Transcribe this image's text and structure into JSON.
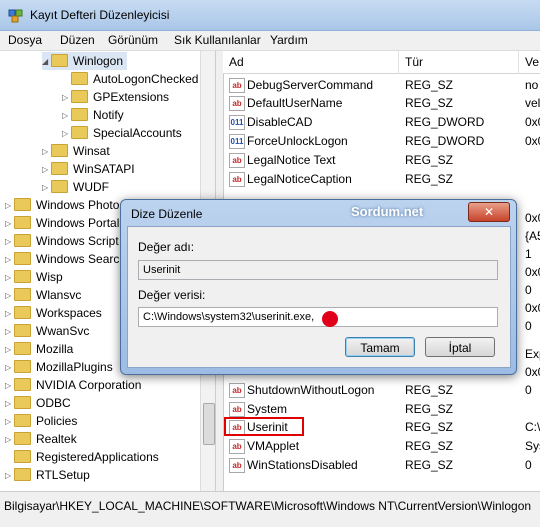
{
  "window": {
    "title": "Kayıt Defteri Düzenleyicisi"
  },
  "menu": [
    "Dosya",
    "Düzen",
    "Görünüm",
    "Sık Kullanılanlar",
    "Yardım"
  ],
  "tree": {
    "items": [
      {
        "label": "Winlogon",
        "expander": "◢"
      },
      {
        "label": "AutoLogonChecked",
        "expander": ""
      },
      {
        "label": "GPExtensions",
        "expander": "▷"
      },
      {
        "label": "Notify",
        "expander": "▷"
      },
      {
        "label": "SpecialAccounts",
        "expander": "▷"
      },
      {
        "label": "Winsat",
        "expander": "▷"
      },
      {
        "label": "WinSATAPI",
        "expander": "▷"
      },
      {
        "label": "WUDF",
        "expander": "▷"
      },
      {
        "label": "Windows Photo",
        "expander": "▷"
      },
      {
        "label": "Windows Portal",
        "expander": "▷"
      },
      {
        "label": "Windows Script",
        "expander": "▷"
      },
      {
        "label": "Windows Search",
        "expander": "▷"
      },
      {
        "label": "Wisp",
        "expander": "▷"
      },
      {
        "label": "Wlansvc",
        "expander": "▷"
      },
      {
        "label": "Workspaces",
        "expander": "▷"
      },
      {
        "label": "WwanSvc",
        "expander": "▷"
      },
      {
        "label": "Mozilla",
        "expander": "▷"
      },
      {
        "label": "MozillaPlugins",
        "expander": "▷"
      },
      {
        "label": "NVIDIA Corporation",
        "expander": "▷"
      },
      {
        "label": "ODBC",
        "expander": "▷"
      },
      {
        "label": "Policies",
        "expander": "▷"
      },
      {
        "label": "Realtek",
        "expander": "▷"
      },
      {
        "label": "RegisteredApplications",
        "expander": ""
      },
      {
        "label": "RTLSetup",
        "expander": "▷"
      }
    ]
  },
  "values": {
    "headers": {
      "name": "Ad",
      "type": "Tür",
      "data": "Ve"
    },
    "rows": [
      {
        "icon": "ab",
        "name": "DebugServerCommand",
        "type": "REG_SZ",
        "data": "no"
      },
      {
        "icon": "ab",
        "name": "DefaultUserName",
        "type": "REG_SZ",
        "data": "vel"
      },
      {
        "icon": "dw",
        "name": "DisableCAD",
        "type": "REG_DWORD",
        "data": "0x0"
      },
      {
        "icon": "dw",
        "name": "ForceUnlockLogon",
        "type": "REG_DWORD",
        "data": "0x0"
      },
      {
        "icon": "ab",
        "name": "LegalNotice Text",
        "type": "REG_SZ",
        "data": ""
      },
      {
        "icon": "ab",
        "name": "LegalNoticeCaption",
        "type": "REG_SZ",
        "data": ""
      },
      {
        "icon": "ab",
        "name": "ShutdownWithoutLogon",
        "type": "REG_SZ",
        "data": "0"
      },
      {
        "icon": "ab",
        "name": "System",
        "type": "REG_SZ",
        "data": ""
      },
      {
        "icon": "ab",
        "name": "Userinit",
        "type": "REG_SZ",
        "data": "C:\\"
      },
      {
        "icon": "ab",
        "name": "VMApplet",
        "type": "REG_SZ",
        "data": "Sys"
      },
      {
        "icon": "ab",
        "name": "WinStationsDisabled",
        "type": "REG_SZ",
        "data": "0"
      }
    ],
    "hidden_data": [
      "0x0",
      "{A5",
      "1",
      "0x0",
      "0",
      "0x0",
      "0",
      "Exp",
      "0x0"
    ]
  },
  "dialog": {
    "title": "Dize Düzenle",
    "watermark": "Sordum.net",
    "close_label": "✕",
    "name_label": "Değer adı:",
    "name_value": "Userinit",
    "data_label": "Değer verisi:",
    "data_value": "C:\\Windows\\system32\\userinit.exe,",
    "ok_label": "Tamam",
    "cancel_label": "İptal"
  },
  "status": {
    "path": "Bilgisayar\\HKEY_LOCAL_MACHINE\\SOFTWARE\\Microsoft\\Windows NT\\CurrentVersion\\Winlogon"
  },
  "colors": {
    "highlight": "#e00000",
    "accent": "#3c7fb1"
  }
}
